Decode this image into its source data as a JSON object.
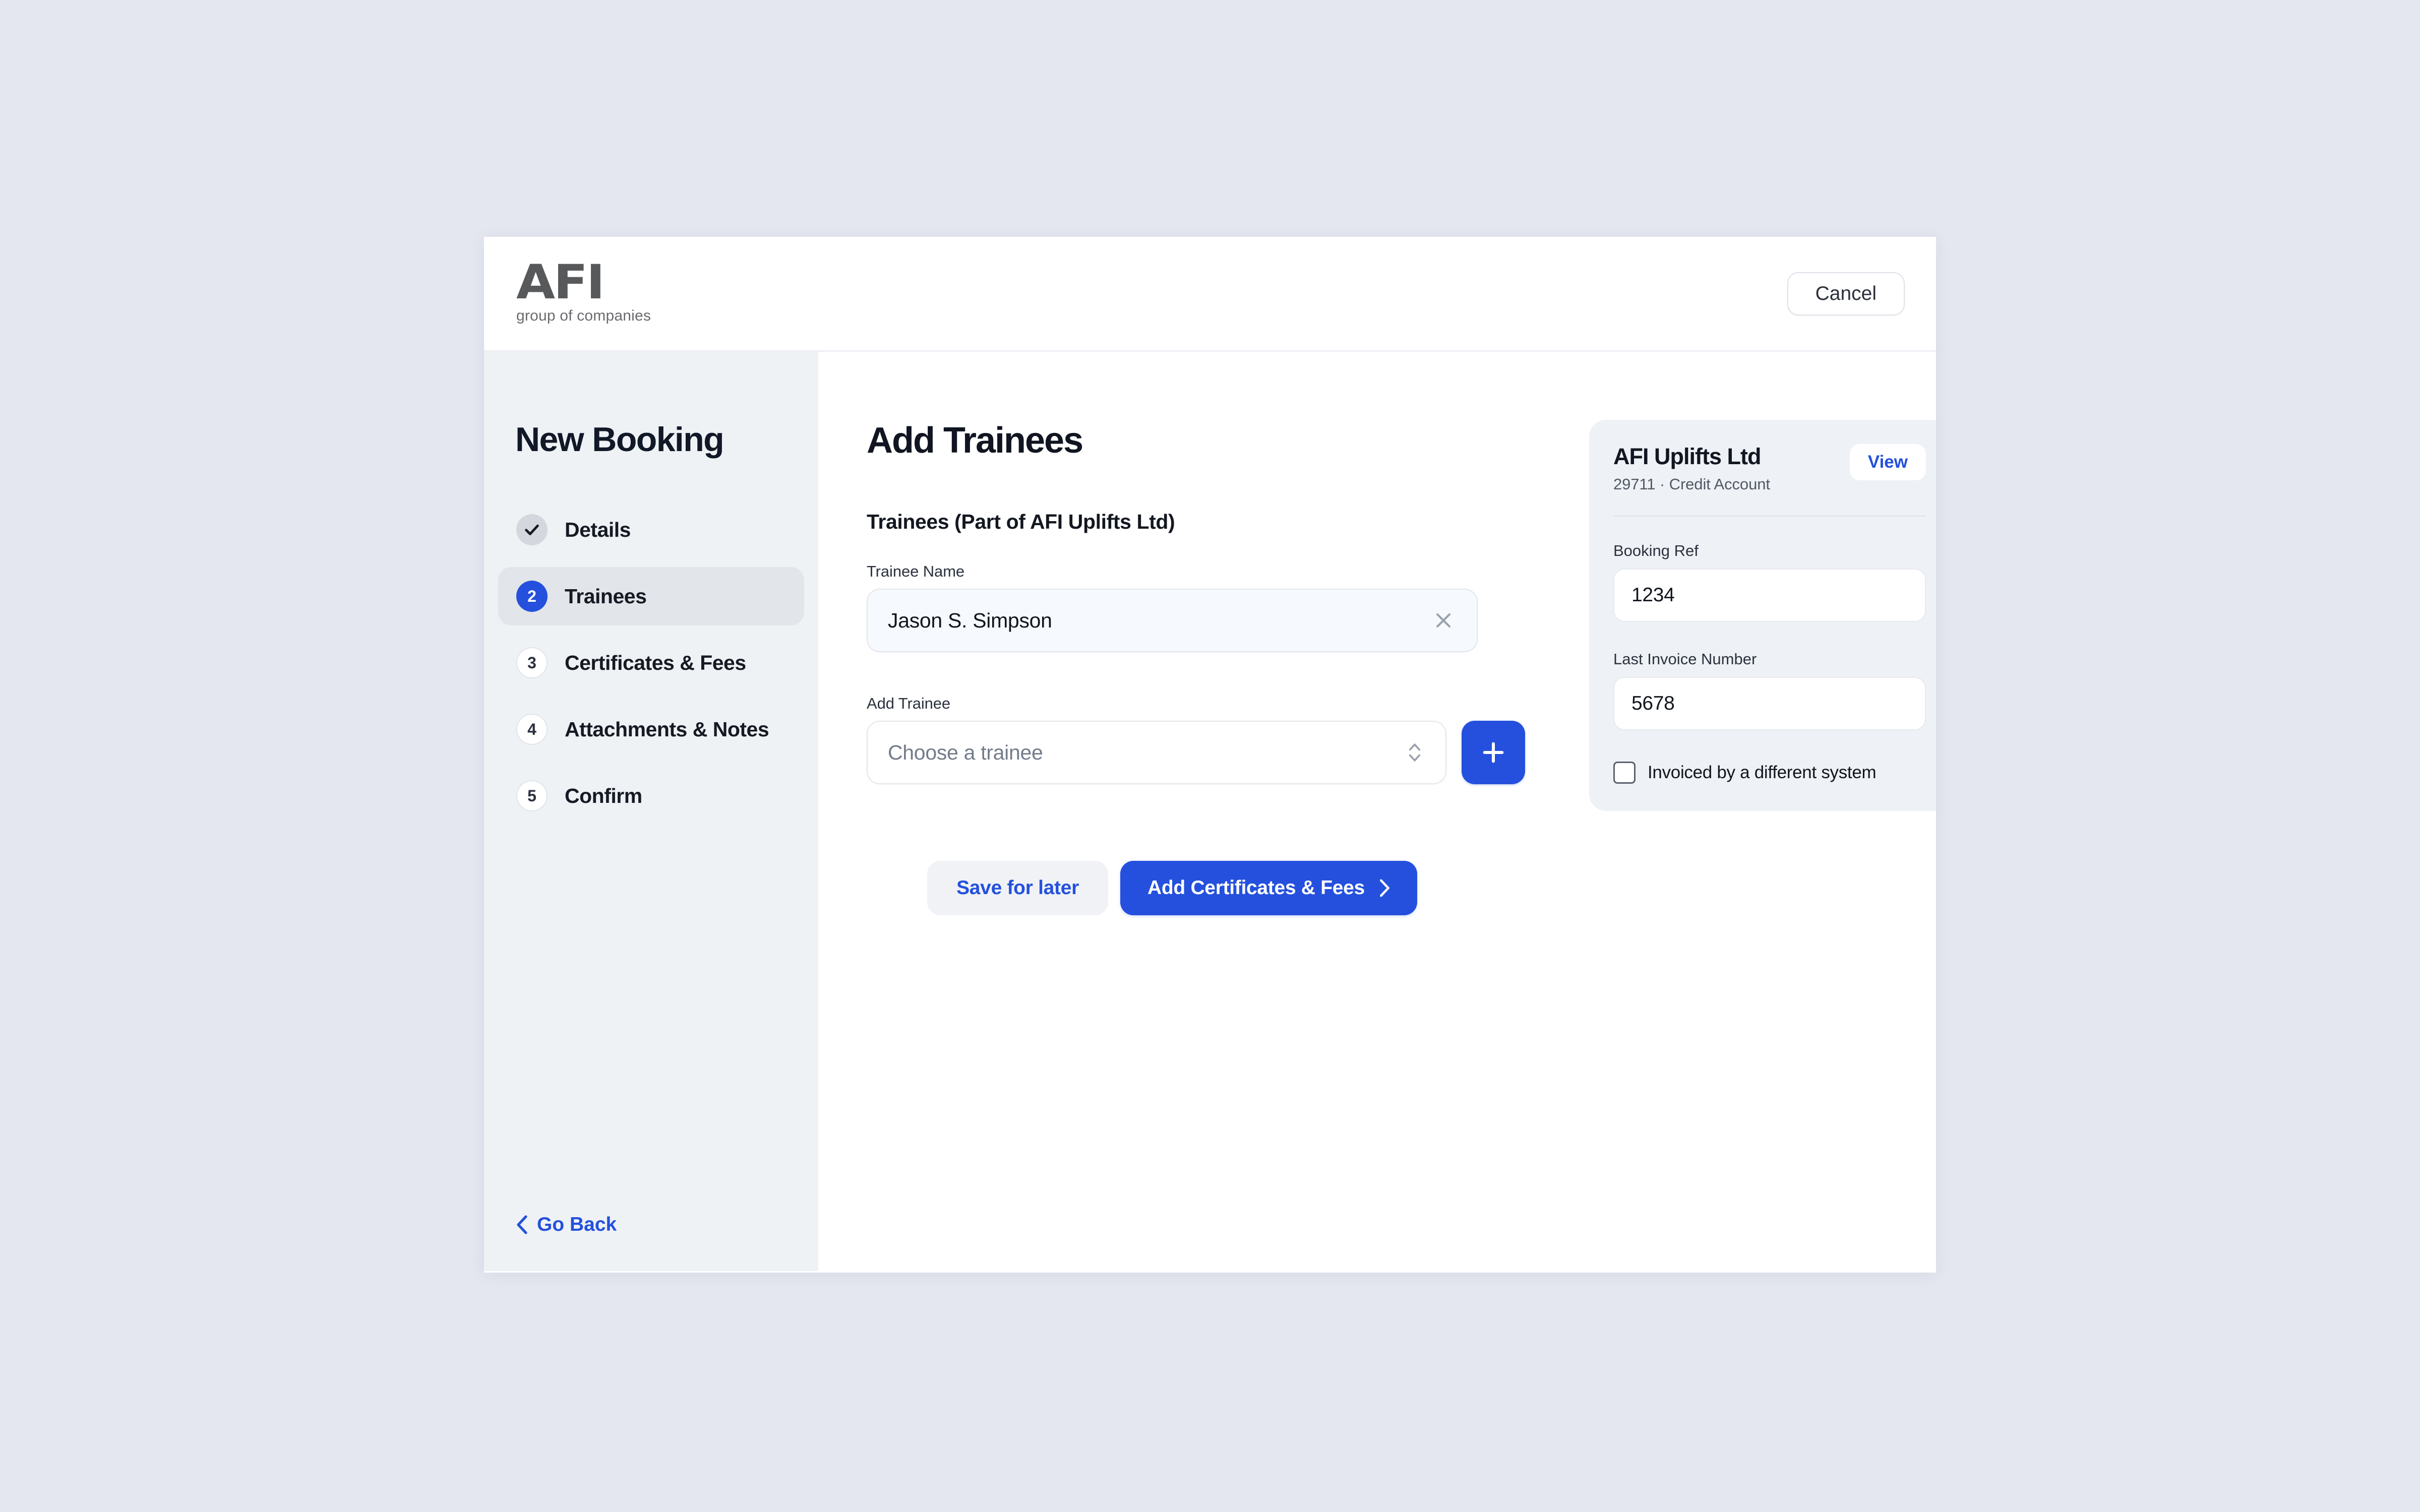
{
  "header": {
    "brand_mark": "AFI",
    "brand_sub": "group of companies",
    "cancel_label": "Cancel"
  },
  "sidebar": {
    "title": "New Booking",
    "steps": [
      {
        "marker": "check-icon",
        "label": "Details",
        "state": "done"
      },
      {
        "marker": "2",
        "label": "Trainees",
        "state": "current"
      },
      {
        "marker": "3",
        "label": "Certificates & Fees",
        "state": "todo"
      },
      {
        "marker": "4",
        "label": "Attachments & Notes",
        "state": "todo"
      },
      {
        "marker": "5",
        "label": "Confirm",
        "state": "todo"
      }
    ],
    "go_back_label": "Go Back"
  },
  "main": {
    "page_title": "Add Trainees",
    "section_title": "Trainees (Part of AFI Uplifts Ltd)",
    "trainee_name_label": "Trainee Name",
    "trainee_name_value": "Jason S. Simpson",
    "add_trainee_label": "Add Trainee",
    "add_trainee_placeholder": "Choose a trainee",
    "add_trainee_value": "",
    "add_button_icon": "plus-icon",
    "save_for_later_label": "Save for later",
    "next_label": "Add Certificates & Fees"
  },
  "account_card": {
    "name": "AFI Uplifts Ltd",
    "meta": "29711 · Credit Account",
    "view_label": "View",
    "booking_ref_label": "Booking Ref",
    "booking_ref_value": "1234",
    "last_invoice_label": "Last Invoice Number",
    "last_invoice_value": "5678",
    "checkbox_label": "Invoiced by a different system",
    "checkbox_checked": false
  },
  "colors": {
    "accent_blue": "#2450dd",
    "page_background": "#e4e7f0",
    "sidebar_background": "#eff2f5",
    "card_background": "#eef1f5",
    "text_primary": "#111621"
  }
}
